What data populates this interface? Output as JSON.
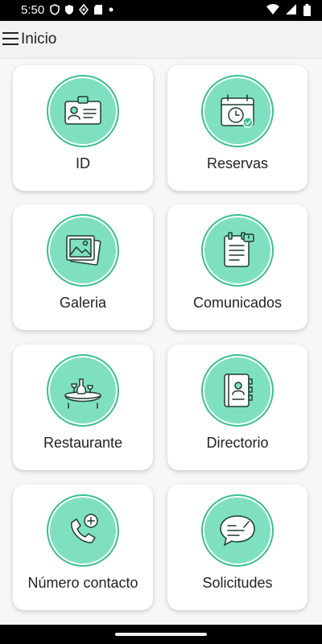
{
  "status": {
    "time": "5:50"
  },
  "header": {
    "title": "Inicio"
  },
  "tiles": [
    {
      "label": "ID",
      "icon": "id-badge-icon"
    },
    {
      "label": "Reservas",
      "icon": "calendar-clock-icon"
    },
    {
      "label": "Galeria",
      "icon": "gallery-icon"
    },
    {
      "label": "Comunicados",
      "icon": "notebook-icon"
    },
    {
      "label": "Restaurante",
      "icon": "restaurant-table-icon"
    },
    {
      "label": "Directorio",
      "icon": "address-book-icon"
    },
    {
      "label": "Número contacto",
      "icon": "phone-plus-icon"
    },
    {
      "label": "Solicitudes",
      "icon": "chat-bubble-icon"
    }
  ],
  "colors": {
    "accent": "#7ee0c0",
    "ring": "#39c08c"
  }
}
